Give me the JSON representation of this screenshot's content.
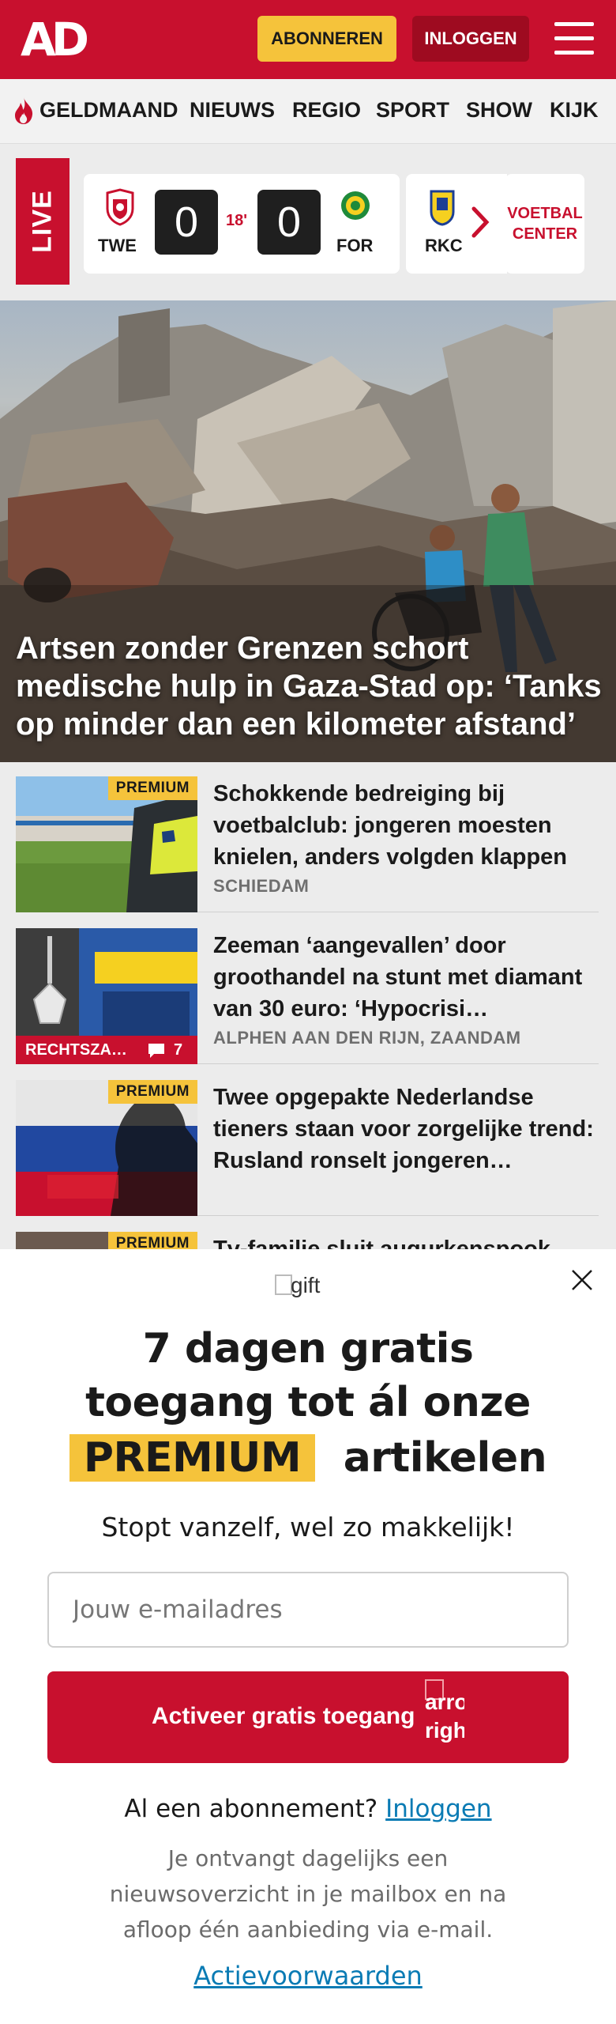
{
  "header": {
    "logo": "AD",
    "subscribe_label": "ABONNEREN",
    "login_label": "INLOGGEN",
    "colors": {
      "brand_red": "#c8102e",
      "premium_yellow": "#f5c33b"
    }
  },
  "nav": {
    "items": [
      {
        "label": "GELDMAAND"
      },
      {
        "label": "NIEUWS"
      },
      {
        "label": "REGIO"
      },
      {
        "label": "SPORT"
      },
      {
        "label": "SHOW"
      },
      {
        "label": "KIJK"
      }
    ]
  },
  "live": {
    "tag": "LIVE",
    "match": {
      "home_code": "TWE",
      "home_score": "0",
      "minute": "18'",
      "away_score": "0",
      "away_code": "FOR"
    },
    "next_match_code": "RKC",
    "voetbal_center": "VOETBAL CENTER"
  },
  "hero": {
    "title": "Artsen zonder Grenzen schort medische hulp in Gaza-Stad op: ‘Tanks op minder dan een kilometer afstand’"
  },
  "articles": [
    {
      "title": "Schokkende bedreiging bij voetbalclub: jongeren moesten knielen, anders volgden klappen",
      "meta": "SCHIEDAM",
      "badge": "PREMIUM"
    },
    {
      "title": "Zeeman ‘aangevallen’ door groothandel na stunt met diamant van 30 euro: ‘Hypocrisi…",
      "meta": "ALPHEN AAN DEN RIJN, ZAANDAM",
      "section": "RECHTSZA…",
      "comments": "7"
    },
    {
      "title": "Twee opgepakte Nederlandse tieners staan voor zorgelijke trend: Rusland ronselt jongeren…",
      "badge": "PREMIUM"
    },
    {
      "title": "Tv-familie sluit augurkenspook",
      "badge": "PREMIUM"
    }
  ],
  "modal": {
    "gift_alt": "gift",
    "heading_line1": "7 dagen gratis",
    "heading_line2": "toegang tot ál onze",
    "heading_premium": "PREMIUM",
    "heading_tail": "artikelen",
    "subtitle": "Stopt vanzelf, wel zo makkelijk!",
    "email_placeholder": "Jouw e-mailadres",
    "activate_label": "Activeer gratis toegang",
    "arrow_alt_1": "arro",
    "arrow_alt_2": "righ",
    "already_text": "Al een abonnement?",
    "already_link": "Inloggen",
    "info_text": "Je ontvangt dagelijks een nieuwsoverzicht in je mailbox en na afloop één aanbieding via e-mail.",
    "conditions_link": "Actievoorwaarden"
  }
}
